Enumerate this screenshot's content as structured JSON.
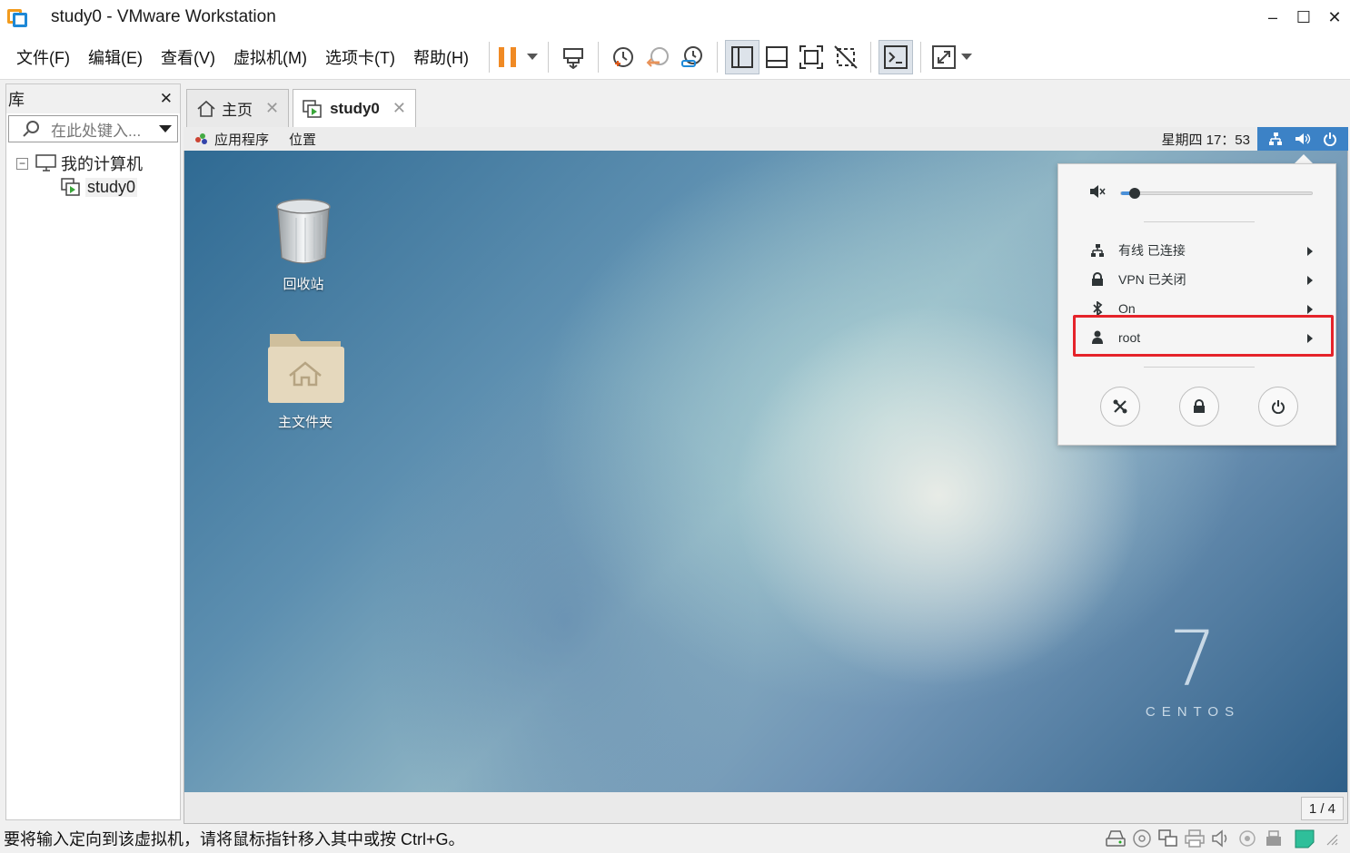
{
  "window": {
    "title": "study0 - VMware Workstation",
    "minimize": "–",
    "maximize": "☐",
    "close": "✕"
  },
  "menu": [
    {
      "label": "文件(F)"
    },
    {
      "label": "编辑(E)"
    },
    {
      "label": "查看(V)"
    },
    {
      "label": "虚拟机(M)"
    },
    {
      "label": "选项卡(T)"
    },
    {
      "label": "帮助(H)"
    }
  ],
  "toolbar": [
    "pause-icon",
    "send-keys-icon",
    "snapshot-icon",
    "revert-snapshot-icon",
    "snapshot-manager-icon",
    "library-view-icon",
    "thumbnail-view-icon",
    "fullscreen-icon",
    "unity-icon",
    "console-icon",
    "stretch-icon"
  ],
  "library": {
    "title": "库",
    "close": "✕",
    "search_placeholder": "在此处键入...",
    "tree": {
      "toggle": "−",
      "root": "我的计算机",
      "child": "study0"
    }
  },
  "tabs": [
    {
      "label": "主页",
      "close": "✕"
    },
    {
      "label": "study0",
      "close": "✕"
    }
  ],
  "gnome": {
    "applications": "应用程序",
    "places": "位置",
    "clock": "星期四 17：53"
  },
  "desktop": {
    "trash_label": "回收站",
    "home_label": "主文件夹",
    "logo_numeral": "7",
    "logo_text": "CENTOS"
  },
  "popup": {
    "volume_level": 0.07,
    "wired": "有线 已连接",
    "vpn": "VPN 已关闭",
    "bluetooth": "On",
    "user": "root"
  },
  "vm_status": {
    "page": "1 / 4"
  },
  "statusbar": {
    "message": "要将输入定向到该虚拟机，请将鼠标指针移入其中或按 Ctrl+G。"
  },
  "colors": {
    "gnome_status_accent": "#3c82c6",
    "highlight": "#e5232a",
    "pause": "#f08a24"
  }
}
